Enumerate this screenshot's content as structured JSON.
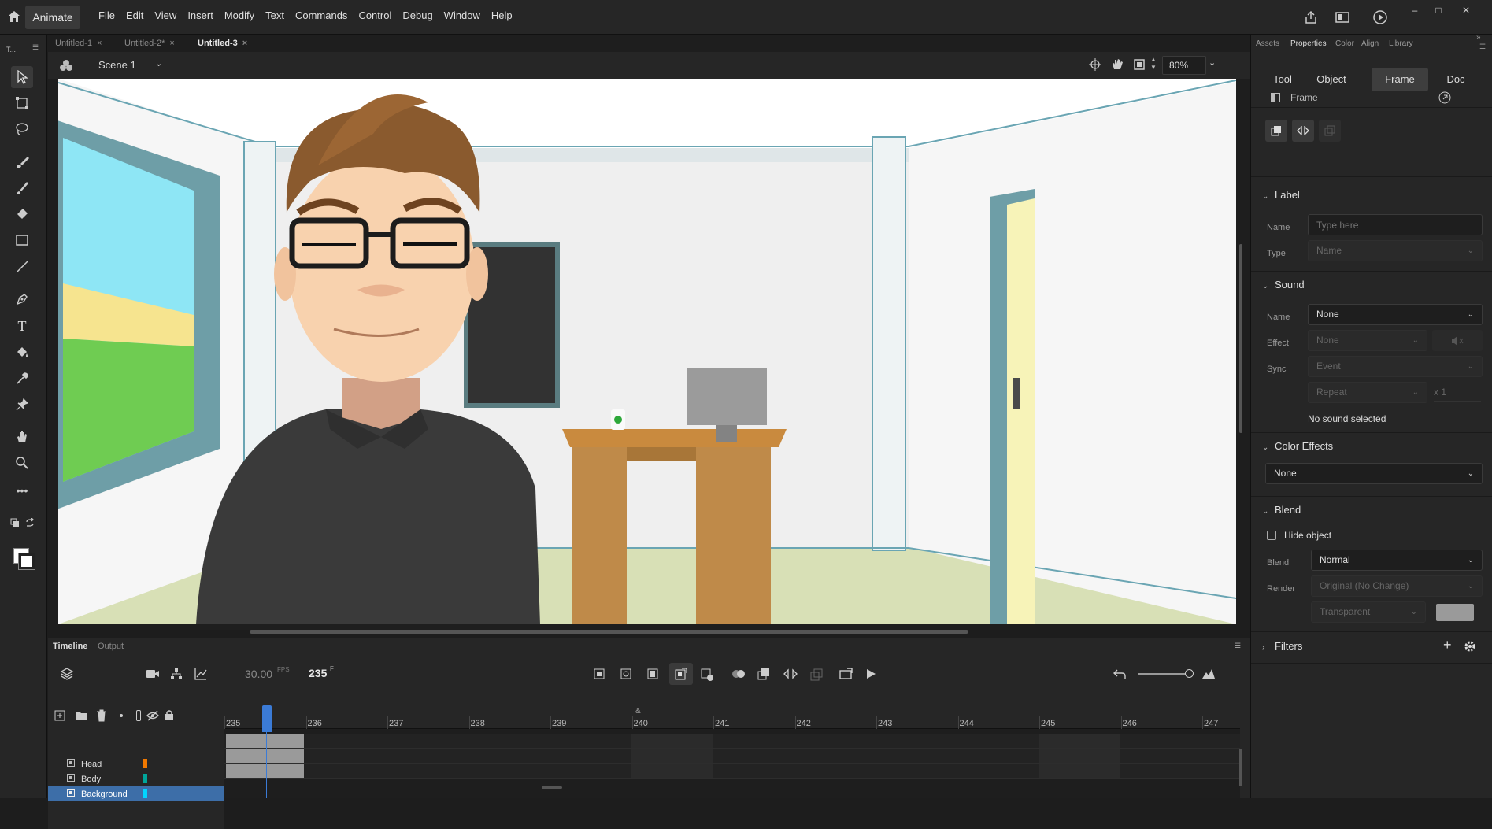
{
  "app": {
    "name": "Animate"
  },
  "menu": [
    "File",
    "Edit",
    "View",
    "Insert",
    "Modify",
    "Text",
    "Commands",
    "Control",
    "Debug",
    "Window",
    "Help"
  ],
  "doc_tabs": [
    {
      "label": "Untitled-1",
      "active": false
    },
    {
      "label": "Untitled-2*",
      "active": false
    },
    {
      "label": "Untitled-3",
      "active": true
    }
  ],
  "toolbar_header": "T...",
  "scene": {
    "name": "Scene 1",
    "zoom": "80%"
  },
  "timeline": {
    "tabs": [
      "Timeline",
      "Output"
    ],
    "fps": "30.00",
    "fps_unit": "FPS",
    "frame": "235",
    "frame_unit": "F",
    "ruler": [
      "235",
      "236",
      "237",
      "238",
      "239",
      "240",
      "241",
      "242",
      "243",
      "244",
      "245",
      "246",
      "247"
    ],
    "label_marker": "&",
    "layers": [
      {
        "name": "Head",
        "color": "#f07800",
        "selected": false
      },
      {
        "name": "Body",
        "color": "#00a59a",
        "selected": false
      },
      {
        "name": "Background",
        "color": "#00d5ff",
        "selected": true
      }
    ]
  },
  "panel": {
    "tabs": [
      "Assets",
      "Properties",
      "Color",
      "Align",
      "Library"
    ],
    "active_tab": "Properties",
    "modes": [
      "Tool",
      "Object",
      "Frame",
      "Doc"
    ],
    "active_mode": "Frame",
    "header": "Frame",
    "label_section": {
      "title": "Label",
      "name_label": "Name",
      "name_placeholder": "Type here",
      "type_label": "Type",
      "type_value": "Name"
    },
    "sound_section": {
      "title": "Sound",
      "name_label": "Name",
      "name_value": "None",
      "effect_label": "Effect",
      "effect_value": "None",
      "sync_label": "Sync",
      "sync_value": "Event",
      "repeat_value": "Repeat",
      "repeat_count": "x 1",
      "status": "No sound selected"
    },
    "color_effects": {
      "title": "Color Effects",
      "value": "None"
    },
    "blend_section": {
      "title": "Blend",
      "hide_object": "Hide object",
      "blend_label": "Blend",
      "blend_value": "Normal",
      "render_label": "Render",
      "render_value": "Original (No Change)",
      "transparent_value": "Transparent"
    },
    "filters": {
      "title": "Filters"
    }
  }
}
